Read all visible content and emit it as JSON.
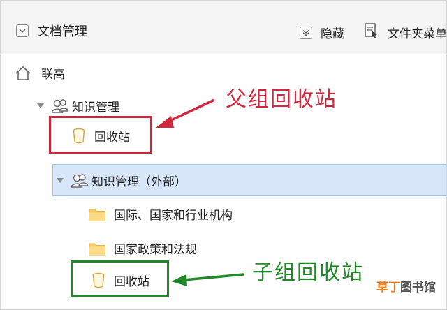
{
  "header": {
    "title": "文档管理",
    "hide_label": "隐藏",
    "folder_menu_label": "文件夹菜单"
  },
  "tree": {
    "root_label": "联高",
    "group_label": "知识管理",
    "group_recycle_label": "回收站",
    "subgroup_label": "知识管理（外部）",
    "folder_1_label": "国际、国家和行业机构",
    "folder_2_label": "国家政策和法规",
    "subgroup_recycle_label": "回收站"
  },
  "annotations": {
    "parent_recycle_label": "父组回收站",
    "child_recycle_label": "子组回收站"
  },
  "watermark": {
    "part1": "草丁",
    "part2": "图书馆"
  },
  "colors": {
    "annotation_red": "#c7283b",
    "annotation_green": "#1f8a27",
    "selection_bg": "#d7e6f8"
  }
}
